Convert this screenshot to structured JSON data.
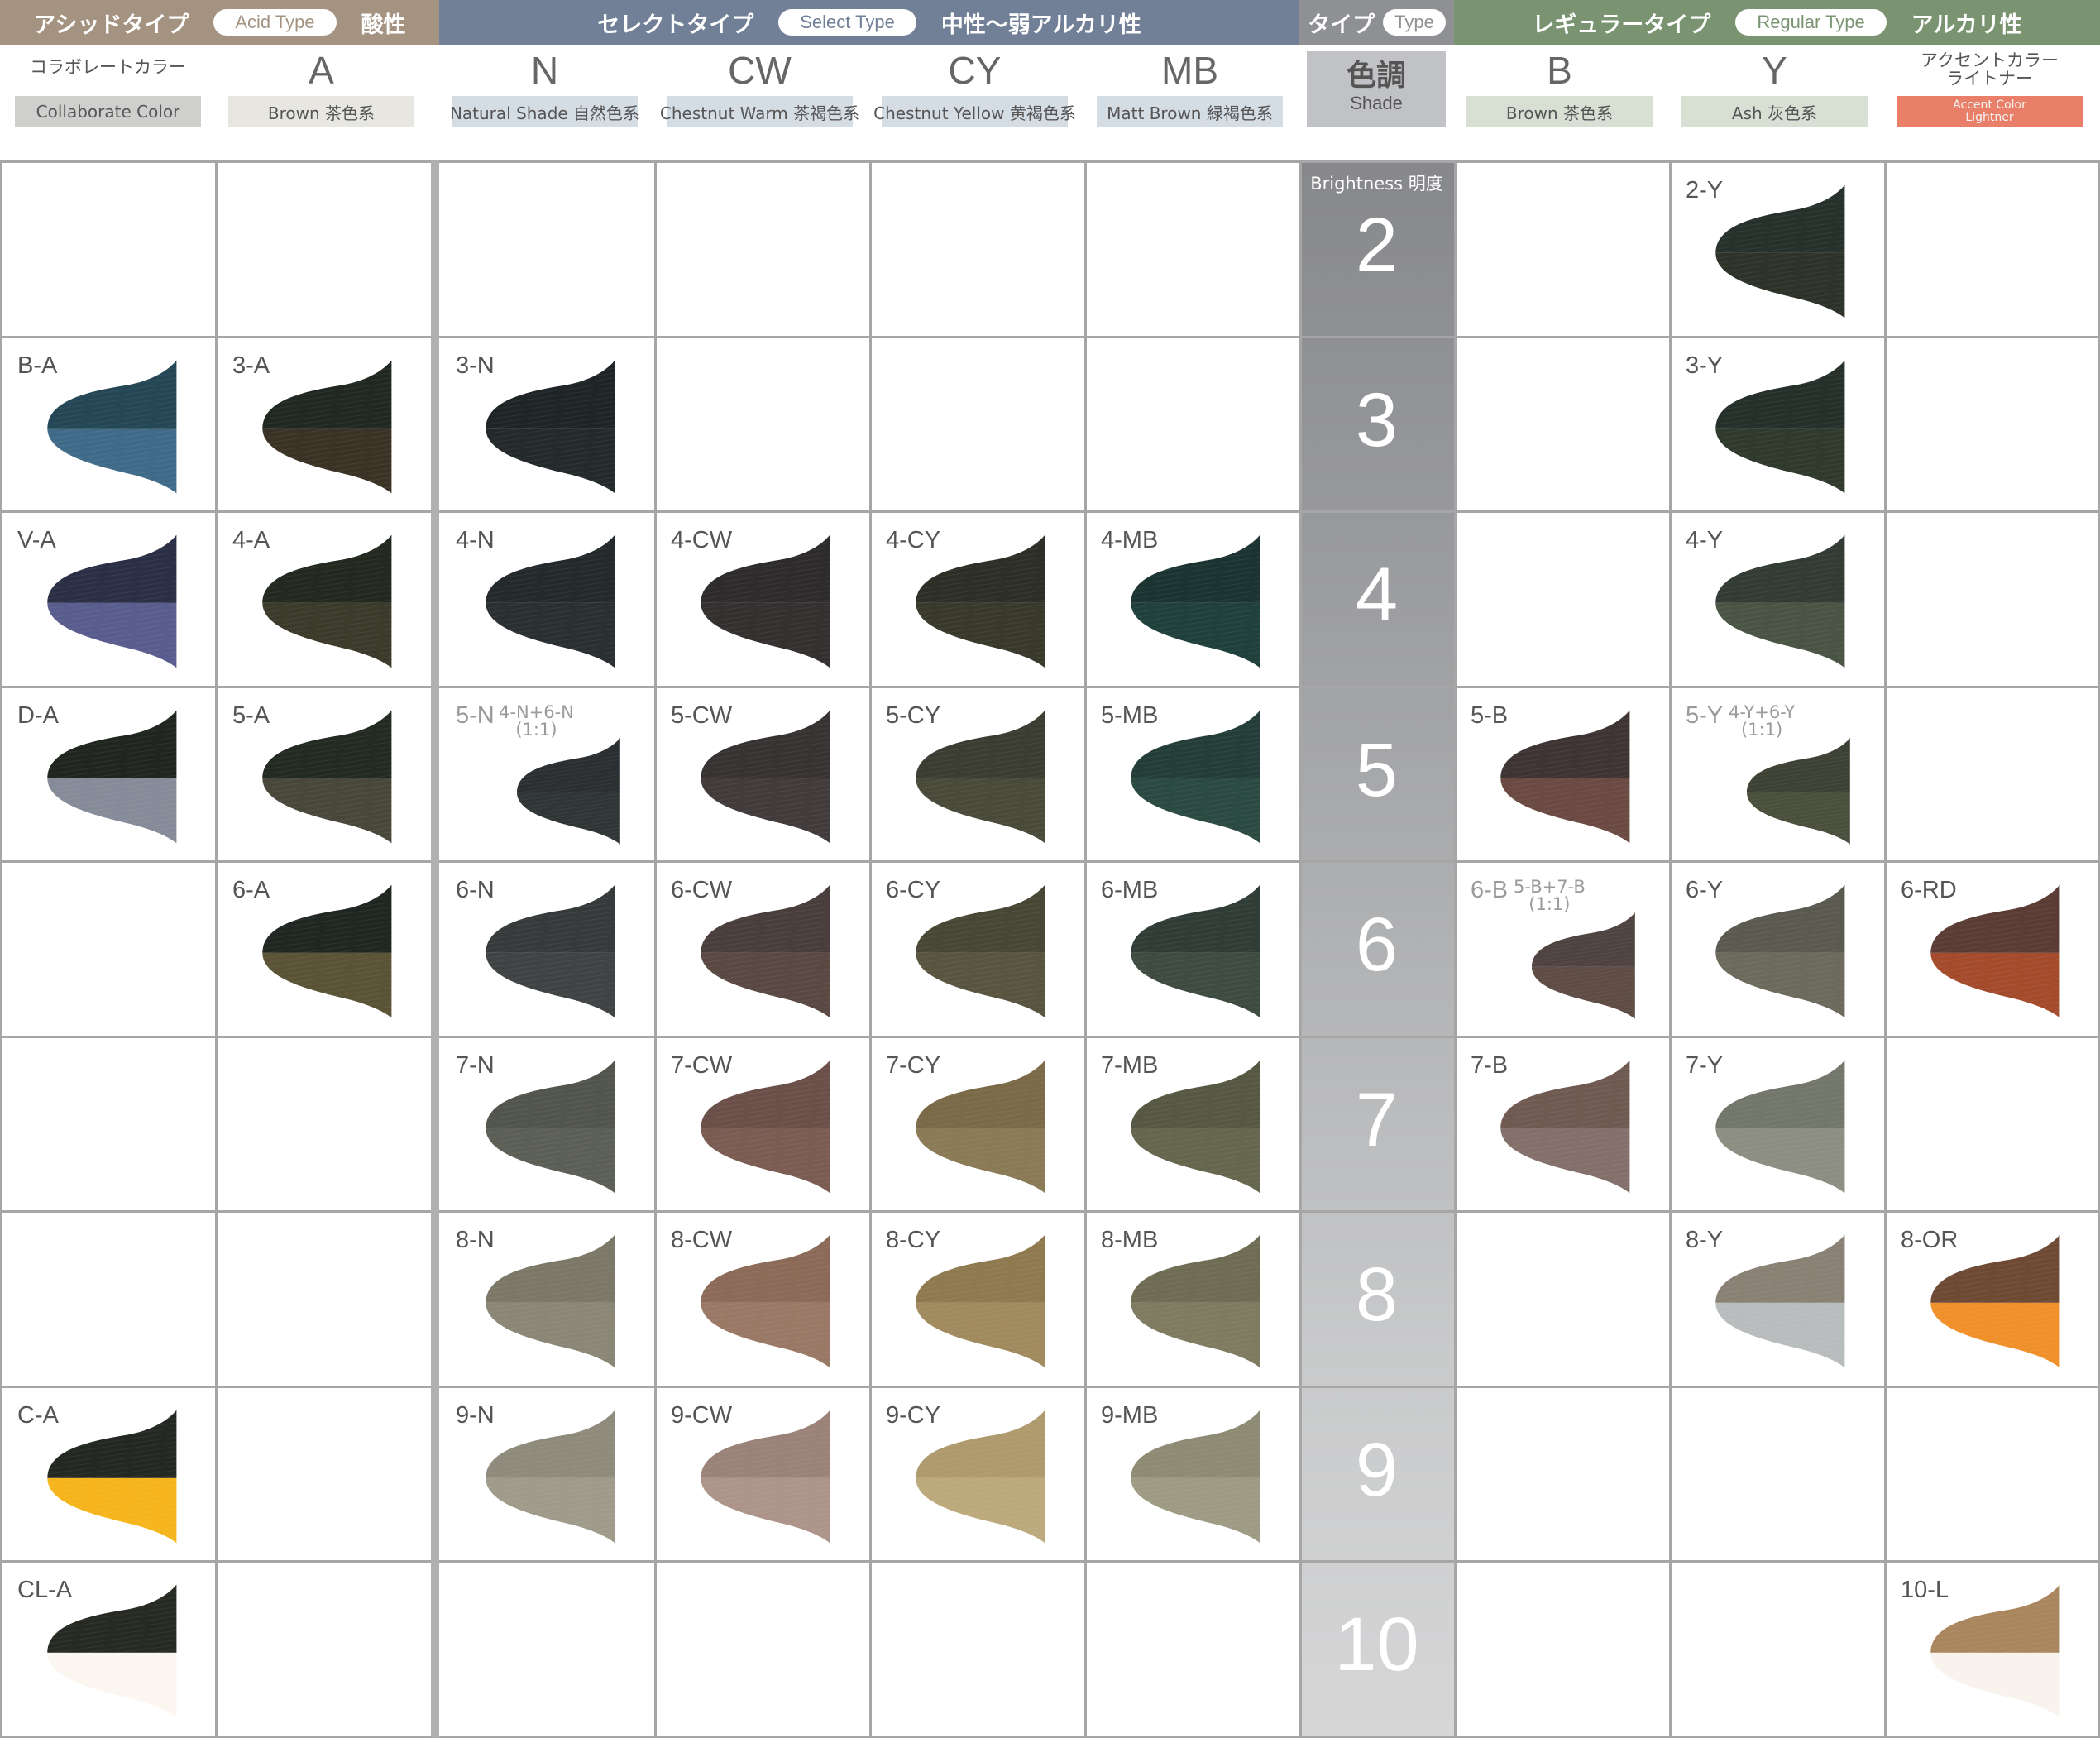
{
  "header": {
    "acid": {
      "title": "アシッドタイプ",
      "pill": "Acid Type",
      "suffix": "酸性"
    },
    "select": {
      "title": "セレクトタイプ",
      "pill": "Select Type",
      "suffix": "中性～弱アルカリ性"
    },
    "type": {
      "title": "タイプ",
      "pill": "Type"
    },
    "regular": {
      "title": "レギュラータイプ",
      "pill": "Regular Type",
      "suffix": "アルカリ性"
    }
  },
  "columns": {
    "collab": {
      "title": "コラボレートカラー",
      "tag": "Collaborate Color"
    },
    "A": {
      "letter": "A",
      "tag": "Brown 茶色系"
    },
    "N": {
      "letter": "N",
      "tag": "Natural Shade 自然色系"
    },
    "CW": {
      "letter": "CW",
      "tag": "Chestnut Warm 茶褐色系"
    },
    "CY": {
      "letter": "CY",
      "tag": "Chestnut Yellow 黄褐色系"
    },
    "MB": {
      "letter": "MB",
      "tag": "Matt Brown 緑褐色系"
    },
    "shade": {
      "jp": "色調",
      "en": "Shade"
    },
    "B": {
      "letter": "B",
      "tag": "Brown 茶色系"
    },
    "Y": {
      "letter": "Y",
      "tag": "Ash 灰色系"
    },
    "accent": {
      "title_line1": "アクセントカラー",
      "title_line2": "ライトナー",
      "tag_line1": "Accent Color",
      "tag_line2": "Lightner"
    }
  },
  "brightness_label": "Brightness 明度",
  "levels": [
    "2",
    "3",
    "4",
    "5",
    "6",
    "7",
    "8",
    "9",
    "10"
  ],
  "colors": {
    "grid_line": "#a6a6a6",
    "acid_bar": "#a59382",
    "select_bar": "#717f97",
    "type_bar": "#8f9094",
    "regular_bar": "#7a9471",
    "accent_tag": "#e97f69"
  },
  "swatches": [
    {
      "label": "2-Y",
      "col": 8,
      "row": 0,
      "top": "#27312c",
      "bottom": "#2d3328"
    },
    {
      "label": "B-A",
      "col": 0,
      "row": 1,
      "top": "#244655",
      "bottom": "#3f6b89"
    },
    {
      "label": "3-A",
      "col": 1,
      "row": 1,
      "top": "#212822",
      "bottom": "#3a3325"
    },
    {
      "label": "3-N",
      "col": 2,
      "row": 1,
      "top": "#1f2527",
      "bottom": "#242a2b"
    },
    {
      "label": "3-Y",
      "col": 8,
      "row": 1,
      "top": "#25302a",
      "bottom": "#2f3a2c"
    },
    {
      "label": "V-A",
      "col": 0,
      "row": 2,
      "top": "#2b2f45",
      "bottom": "#595d8e"
    },
    {
      "label": "4-A",
      "col": 1,
      "row": 2,
      "top": "#23291f",
      "bottom": "#3b3a2b"
    },
    {
      "label": "4-N",
      "col": 2,
      "row": 2,
      "top": "#24292c",
      "bottom": "#2a3032"
    },
    {
      "label": "4-CW",
      "col": 3,
      "row": 2,
      "top": "#2d2b2b",
      "bottom": "#34302f"
    },
    {
      "label": "4-CY",
      "col": 4,
      "row": 2,
      "top": "#2d2f27",
      "bottom": "#39392b"
    },
    {
      "label": "4-MB",
      "col": 5,
      "row": 2,
      "top": "#1c3431",
      "bottom": "#20403b"
    },
    {
      "label": "4-Y",
      "col": 8,
      "row": 2,
      "top": "#333b35",
      "bottom": "#4a5444"
    },
    {
      "label": "D-A",
      "col": 0,
      "row": 3,
      "top": "#20261f",
      "bottom": "#868b99"
    },
    {
      "label": "5-A",
      "col": 1,
      "row": 3,
      "top": "#222a22",
      "bottom": "#48473a"
    },
    {
      "label": "5-N",
      "col": 2,
      "row": 3,
      "mix": "4-N+6-N",
      "ratio": "(1:1)",
      "top": "#2b2f31",
      "bottom": "#303536"
    },
    {
      "label": "5-CW",
      "col": 3,
      "row": 3,
      "top": "#373333",
      "bottom": "#423b3b"
    },
    {
      "label": "5-CY",
      "col": 4,
      "row": 3,
      "top": "#3b3c32",
      "bottom": "#4a4a3a"
    },
    {
      "label": "5-MB",
      "col": 5,
      "row": 3,
      "top": "#243d38",
      "bottom": "#2b4a42"
    },
    {
      "label": "5-B",
      "col": 6,
      "row": 3,
      "top": "#3e3433",
      "bottom": "#6a4a42"
    },
    {
      "label": "5-Y",
      "col": 8,
      "row": 3,
      "mix": "4-Y+6-Y",
      "ratio": "(1:1)",
      "top": "#3e4234",
      "bottom": "#4b4f3d"
    },
    {
      "label": "6-A",
      "col": 1,
      "row": 4,
      "top": "#202621",
      "bottom": "#5b5336"
    },
    {
      "label": "6-N",
      "col": 2,
      "row": 4,
      "top": "#363a3a",
      "bottom": "#3f4343"
    },
    {
      "label": "6-CW",
      "col": 3,
      "row": 4,
      "top": "#4a3e3c",
      "bottom": "#5a4843"
    },
    {
      "label": "6-CY",
      "col": 4,
      "row": 4,
      "top": "#484634",
      "bottom": "#585440"
    },
    {
      "label": "6-MB",
      "col": 5,
      "row": 4,
      "top": "#303d36",
      "bottom": "#3d4b40"
    },
    {
      "label": "6-B",
      "col": 6,
      "row": 4,
      "mix": "5-B+7-B",
      "ratio": "(1:1)",
      "top": "#4f4340",
      "bottom": "#5e4c45"
    },
    {
      "label": "6-Y",
      "col": 8,
      "row": 4,
      "top": "#5a5a50",
      "bottom": "#6b6a5c"
    },
    {
      "label": "6-RD",
      "col": 9,
      "row": 4,
      "top": "#5a3c34",
      "bottom": "#a44b2c"
    },
    {
      "label": "7-N",
      "col": 2,
      "row": 5,
      "top": "#52554c",
      "bottom": "#5c5f55"
    },
    {
      "label": "7-CW",
      "col": 3,
      "row": 5,
      "top": "#6b5049",
      "bottom": "#7a5c53"
    },
    {
      "label": "7-CY",
      "col": 4,
      "row": 5,
      "top": "#7a6a48",
      "bottom": "#8a7a55"
    },
    {
      "label": "7-MB",
      "col": 5,
      "row": 5,
      "top": "#565843",
      "bottom": "#65664d"
    },
    {
      "label": "7-B",
      "col": 6,
      "row": 5,
      "top": "#6f5a52",
      "bottom": "#84706a"
    },
    {
      "label": "7-Y",
      "col": 8,
      "row": 5,
      "top": "#73766a",
      "bottom": "#8c8e82"
    },
    {
      "label": "8-N",
      "col": 2,
      "row": 6,
      "top": "#7b7868",
      "bottom": "#8a8776"
    },
    {
      "label": "8-CW",
      "col": 3,
      "row": 6,
      "top": "#8b6a58",
      "bottom": "#9a7866"
    },
    {
      "label": "8-CY",
      "col": 4,
      "row": 6,
      "top": "#8f7a50",
      "bottom": "#a08a5e"
    },
    {
      "label": "8-MB",
      "col": 5,
      "row": 6,
      "top": "#6e6c53",
      "bottom": "#7e7b60"
    },
    {
      "label": "8-Y",
      "col": 8,
      "row": 6,
      "top": "#8a8175",
      "bottom": "#b8bcbd"
    },
    {
      "label": "8-OR",
      "col": 9,
      "row": 6,
      "top": "#6e4a34",
      "bottom": "#f0902a"
    },
    {
      "label": "C-A",
      "col": 0,
      "row": 7,
      "top": "#232822",
      "bottom": "#f6b51c"
    },
    {
      "label": "9-N",
      "col": 2,
      "row": 7,
      "top": "#8e8b7c",
      "bottom": "#9f9b8b"
    },
    {
      "label": "9-CW",
      "col": 3,
      "row": 7,
      "top": "#9b8279",
      "bottom": "#ad948a"
    },
    {
      "label": "9-CY",
      "col": 4,
      "row": 7,
      "top": "#ae9a6c",
      "bottom": "#bca97c"
    },
    {
      "label": "9-MB",
      "col": 5,
      "row": 7,
      "top": "#8d8b74",
      "bottom": "#9e9b84"
    },
    {
      "label": "CL-A",
      "col": 0,
      "row": 8,
      "top": "#262a22",
      "bottom": "#fbf6f0"
    },
    {
      "label": "10-L",
      "col": 9,
      "row": 8,
      "top": "#a9865e",
      "bottom": "#f8f3ec"
    }
  ]
}
